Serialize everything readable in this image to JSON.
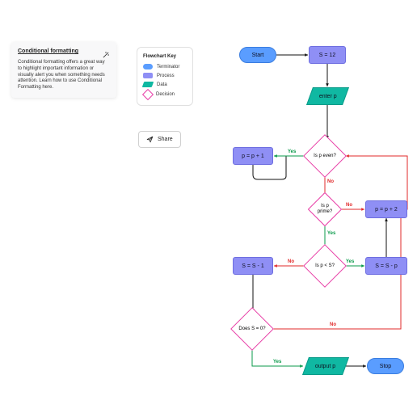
{
  "tip": {
    "title": "Conditional formatting",
    "body": "Conditional formatting offers a great way to highlight important information or visually alert you when something needs attention. Learn how to use Conditional Formatting here."
  },
  "legend": {
    "title": "Flowchart Key",
    "terminator": "Terminator",
    "process": "Process",
    "data": "Data",
    "decision": "Decision"
  },
  "share": {
    "label": "Share"
  },
  "nodes": {
    "start": "Start",
    "s12": "S = 12",
    "enter": "enter p",
    "even": "Is p even?",
    "pplus1": "p = p + 1",
    "prime": "Is p prime?",
    "pplus2": "p = p + 2",
    "plts": "Is p < S?",
    "sminus1": "S = S - 1",
    "sminusp": "S = S - p",
    "seq0": "Does S = 0?",
    "output": "output p",
    "stop": "Stop"
  },
  "labels": {
    "yes": "Yes",
    "no": "No"
  }
}
